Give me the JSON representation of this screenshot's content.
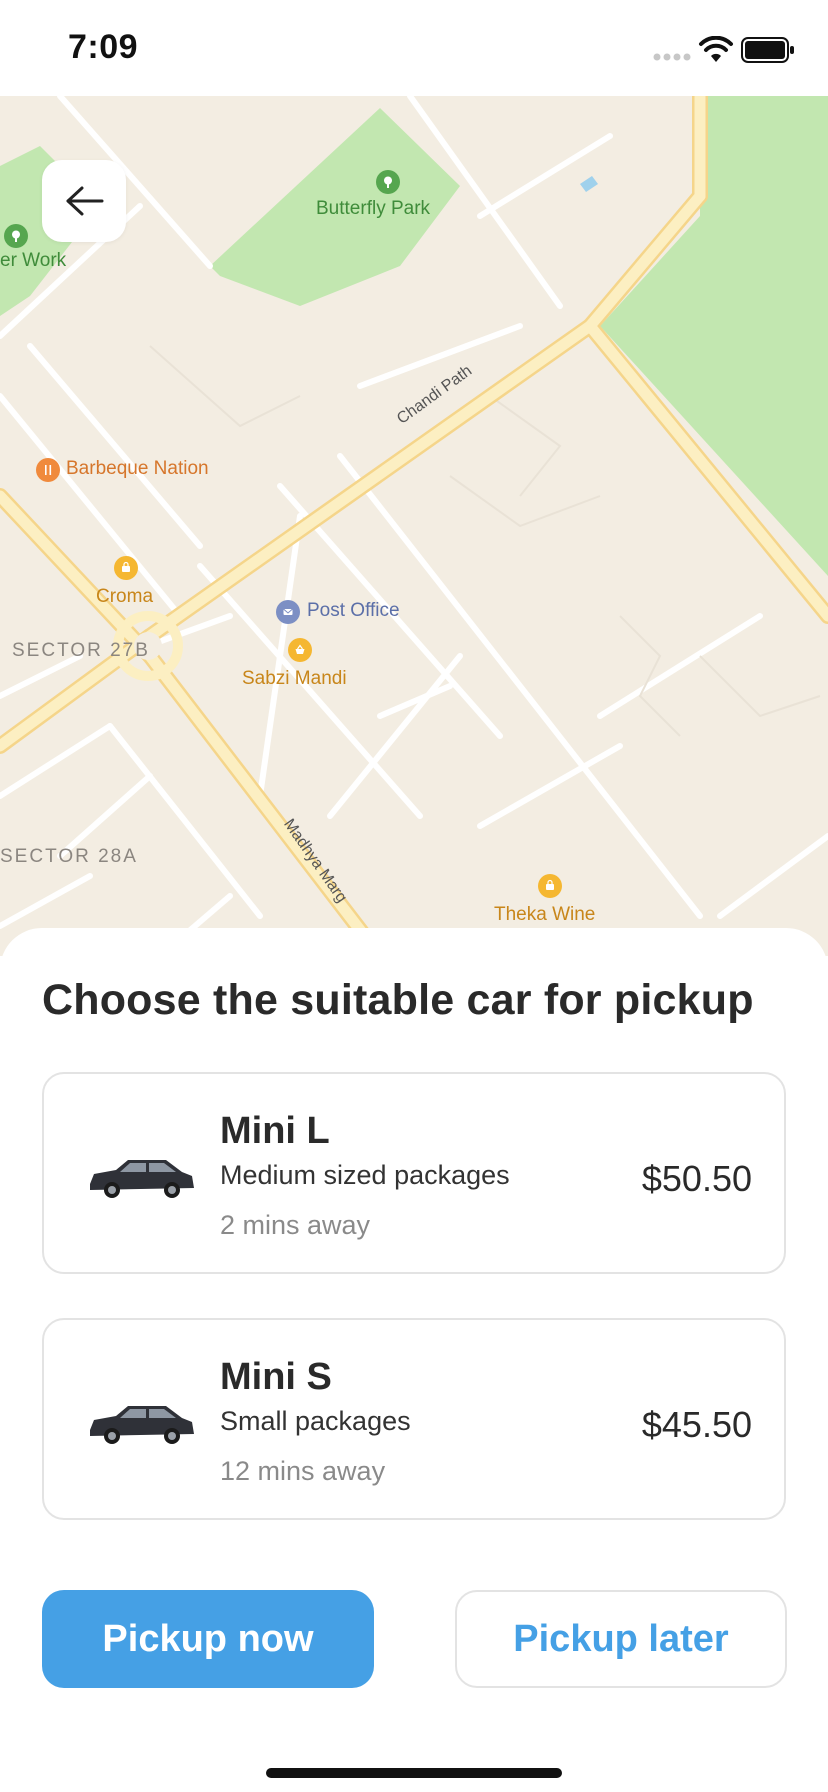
{
  "status_bar": {
    "time": "7:09"
  },
  "map": {
    "labels": {
      "butterfly_park": "Butterfly Park",
      "partial_work": "er Work",
      "chandi_path": "Chandi Path",
      "barbeque_nation": "Barbeque Nation",
      "croma": "Croma",
      "post_office": "Post Office",
      "sabzi_mandi": "Sabzi Mandi",
      "sector_27b": "SECTOR 27B",
      "sector_28a": "SECTOR 28A",
      "madhya_marg": "Madhya Marg",
      "theka_wine": "Theka Wine"
    },
    "icons": {
      "back": "arrow-left-icon",
      "park": "tree-icon",
      "restaurant": "fork-knife-icon",
      "shop": "shopping-bag-icon",
      "post": "envelope-icon",
      "market": "basket-icon"
    }
  },
  "sheet": {
    "title": "Choose the suitable car for pickup",
    "cars": [
      {
        "name": "Mini L",
        "description": "Medium sized packages",
        "eta": "2 mins away",
        "price": "$50.50",
        "icon": "suv-car-icon"
      },
      {
        "name": "Mini S",
        "description": "Small packages",
        "eta": "12 mins away",
        "price": "$45.50",
        "icon": "suv-car-icon"
      }
    ],
    "actions": {
      "pickup_now": "Pickup now",
      "pickup_later": "Pickup later"
    }
  },
  "colors": {
    "accent": "#45a0e5",
    "map_background": "#f3ede2",
    "park_green": "#c2e7b0",
    "main_road": "#fce8a8",
    "text_dark": "#2a2a2a",
    "text_muted": "#8a8a8a"
  }
}
